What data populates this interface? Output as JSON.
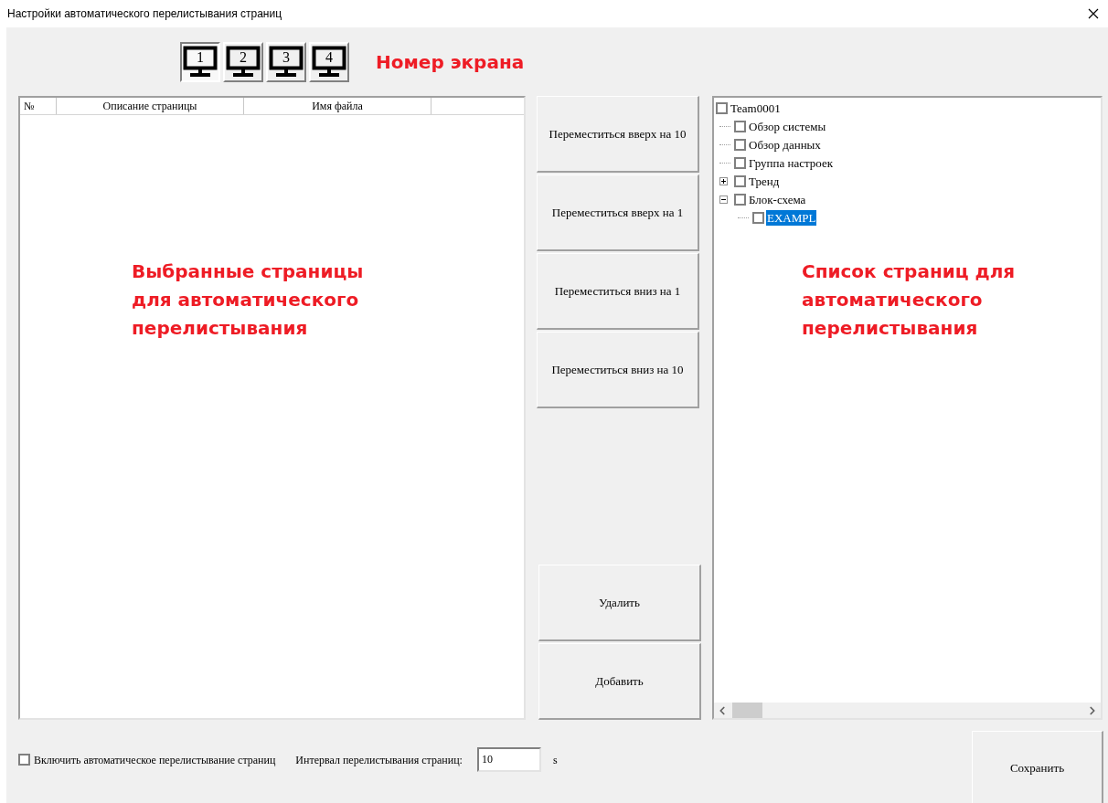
{
  "window": {
    "title": "Настройки автоматического перелистывания страниц"
  },
  "screens": [
    {
      "label": "1",
      "selected": true
    },
    {
      "label": "2",
      "selected": false
    },
    {
      "label": "3",
      "selected": false
    },
    {
      "label": "4",
      "selected": false
    }
  ],
  "screen_annotation": "Номер экрана",
  "table": {
    "columns": [
      "№",
      "Описание страницы",
      "Имя файла"
    ]
  },
  "left_annotation": "Выбранные страницы для автоматического перелистывания",
  "move_buttons": [
    "Переместиться вверх на 10",
    "Переместиться вверх на 1",
    "Переместиться вниз на 1",
    "Переместиться вниз на 10"
  ],
  "action_buttons": [
    "Удалить",
    "Добавить"
  ],
  "tree": [
    {
      "label": "Team0001",
      "checked": false,
      "selected": false,
      "children": [
        {
          "label": "Обзор системы",
          "checked": false,
          "selected": false
        },
        {
          "label": "Обзор данных",
          "checked": false,
          "selected": false
        },
        {
          "label": "Группа настроек",
          "checked": false,
          "selected": false
        },
        {
          "label": "Тренд",
          "checked": false,
          "selected": false,
          "expanded": false
        },
        {
          "label": "Блок-схема",
          "checked": false,
          "selected": false,
          "expanded": true,
          "children": [
            {
              "label": "EXAMPL",
              "checked": false,
              "selected": true
            }
          ]
        }
      ]
    }
  ],
  "right_annotation": "Список страниц для автоматического перелистывания",
  "auto_flip": {
    "label": "Включить автоматическое перелистывание страниц",
    "checked": false
  },
  "interval": {
    "label": "Интервал перелистывания страниц:",
    "value": "10",
    "unit": "s"
  },
  "save_button": "Сохранить"
}
